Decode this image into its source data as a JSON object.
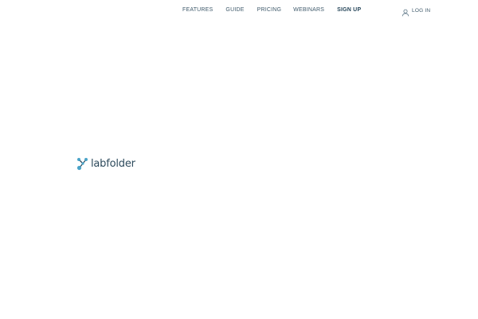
{
  "nav": {
    "items": [
      {
        "label": "FEATURES"
      },
      {
        "label": "GUIDE"
      },
      {
        "label": "PRICING"
      },
      {
        "label": "WEBINARS"
      },
      {
        "label": "SIGN UP"
      }
    ],
    "login": {
      "label": "LOG IN",
      "icon": "user-icon"
    }
  },
  "logo": {
    "text": "labfolder",
    "icon": "labfolder-logo-icon"
  },
  "colors": {
    "text": "#3f5a6b",
    "text_strong": "#26465a",
    "logo_text": "#2d4a5c",
    "logo_accent": "#4aa3c8",
    "background": "#ffffff"
  }
}
